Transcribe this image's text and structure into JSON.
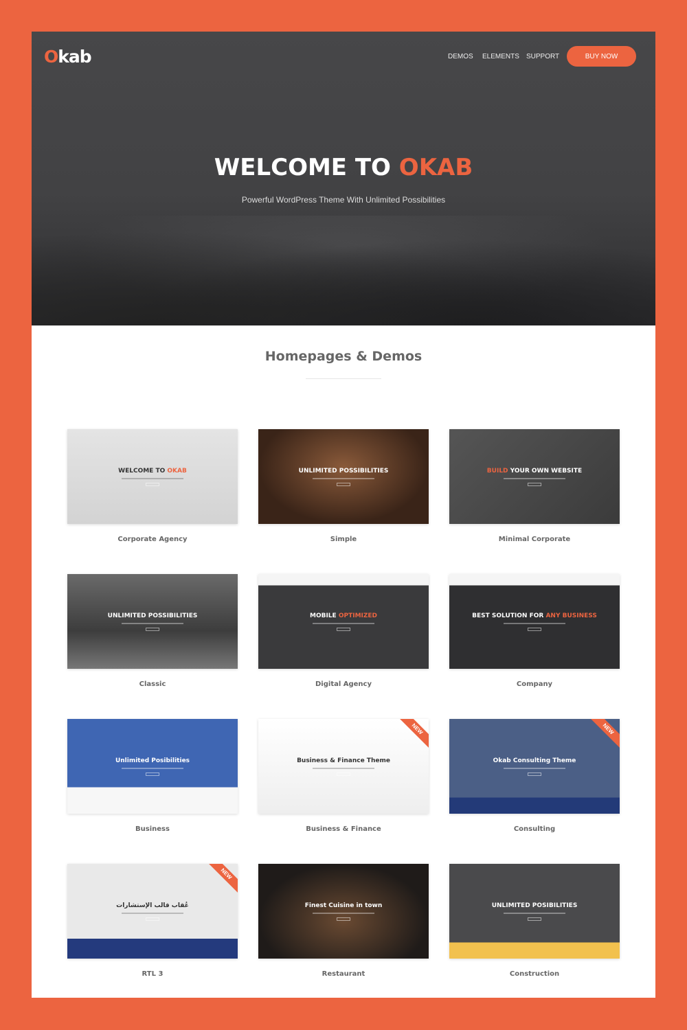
{
  "header": {
    "logo_o": "O",
    "logo_rest": "kab",
    "nav": [
      "DEMOS",
      "ELEMENTS",
      "SUPPORT"
    ],
    "buy": "BUY NOW"
  },
  "hero": {
    "title_a": "WELCOME TO ",
    "title_b": "OKAB",
    "subtitle": "Powerful WordPress Theme With Unlimited Possibilities"
  },
  "section": {
    "title": "Homepages & Demos"
  },
  "colors": {
    "accent": "#ec6440",
    "hero_bg": "#434345"
  },
  "demos": [
    {
      "label": "Corporate Agency",
      "h1": "WELCOME TO ",
      "h2": "OKAB",
      "bg": "linear-gradient(#e4e4e4,#d3d3d3)",
      "dark": true,
      "new": false
    },
    {
      "label": "Simple",
      "h1": "UNLIMITED POSSIBILITIES",
      "h2": "",
      "bg": "radial-gradient(ellipse at 50% 40%,#8a5a3a,#3a2418 70%)",
      "new": false
    },
    {
      "label": "Minimal Corporate",
      "h1": "",
      "h2": "BUILD",
      "h3": " YOUR OWN WEBSITE",
      "bg": "linear-gradient(135deg,#555,#3b3b3b)",
      "new": false
    },
    {
      "label": "Classic",
      "h1": "UNLIMITED POSSIBILITIES",
      "h2": "",
      "bg": "linear-gradient(#6a6a6a,#3d3d3d 60%,#777)",
      "new": false
    },
    {
      "label": "Digital Agency",
      "h1": "MOBILE ",
      "h2": "OPTIMIZED",
      "bg": "linear-gradient(#f5f5f5 0 12%,#3a3a3c 12%)",
      "new": false
    },
    {
      "label": "Company",
      "h1": "BEST SOLUTION FOR ",
      "h2": "ANY BUSINESS",
      "bg": "linear-gradient(#f5f5f5 0 12%,#2f2f31 12%)",
      "new": false
    },
    {
      "label": "Business",
      "h1": "Unlimited Posibilities",
      "h2": "",
      "bg": "linear-gradient(#3f66b3 0 72%,#f7f7f7 72%)",
      "new": false
    },
    {
      "label": "Business & Finance",
      "h1": "Business & Finance Theme",
      "h2": "",
      "bg": "linear-gradient(#fff,#eee)",
      "dark": true,
      "new": true
    },
    {
      "label": "Consulting",
      "h1": "Okab Consulting Theme",
      "h2": "",
      "bg": "linear-gradient(#4b5f86 0 83%,#233a78 83%)",
      "new": true
    },
    {
      "label": "RTL 3",
      "h1": "عُقاب قالب الإستشارات",
      "h2": "",
      "bg": "linear-gradient(#e9e9e9 0 79%,#243a7d 79%)",
      "dark": true,
      "new": true
    },
    {
      "label": "Restaurant",
      "h1": "Finest Cuisine in town",
      "h2": "",
      "bg": "radial-gradient(ellipse at 50% 60%,#6a4a32,#1f1b19 70%)",
      "new": false
    },
    {
      "label": "Construction",
      "h1": "UNLIMITED POSIBILITIES",
      "h2": "",
      "bg": "linear-gradient(#4a4a4c 0 83%,#f2c14e 83%)",
      "new": false
    }
  ],
  "new_badge": "NEW"
}
